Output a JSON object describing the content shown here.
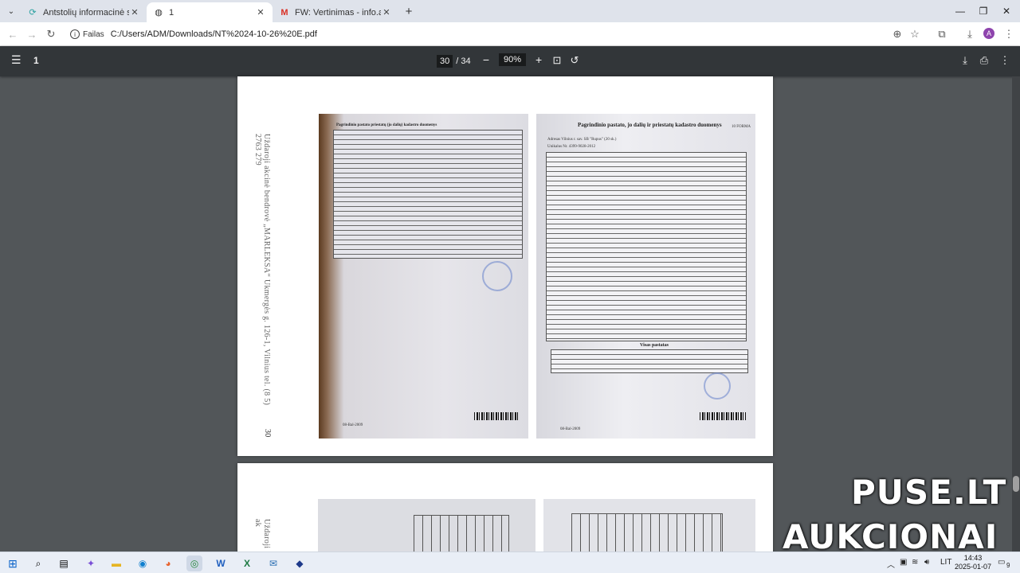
{
  "browser": {
    "tabs": [
      {
        "title": "Antstolių informacinė sistema",
        "icon": "antstoliai-icon",
        "active": false
      },
      {
        "title": "1",
        "icon": "globe-icon",
        "active": true
      },
      {
        "title": "FW: Vertinimas - info.antstoliai@",
        "icon": "gmail-icon",
        "active": false
      }
    ],
    "address": {
      "site_label": "Failas",
      "url": "C:/Users/ADM/Downloads/NT%2024-10-26%20E.pdf"
    },
    "profile_initial": "A"
  },
  "pdf": {
    "title": "1",
    "current_page": "30",
    "page_total": "/ 34",
    "zoom": "90%"
  },
  "page30": {
    "side_text": "Uždaroji akcinė bendrovė „MARLEKSA“  Ukmergės g. 126-1, Vilnius   tel. (8 5) 2763 279",
    "page_number": "30",
    "right_photo": {
      "heading": "Pagrindinio pastato, jo dalių ir priestatų kadastro duomenys",
      "address_line": "Adresas  Vilnius r. sav. SB \"Rupus\" (20 sk.)",
      "code_line": "Unikalus Nr.   4399-9028-2012",
      "form_label": "10 FORMA",
      "totals_heading": "Visas pastatas",
      "date": "08-Bal-2009"
    },
    "left_photo": {
      "heading": "Pagrindinio pastato priestatų (jo dalių) kadastro duomenys",
      "date": "08-Bal-2009"
    }
  },
  "page31": {
    "side_text": "Uždaroji ak"
  },
  "watermark": {
    "line1": "PUSE.LT",
    "line2": "AUKCIONAI"
  },
  "taskbar": {
    "language": "LIT",
    "time": "14:43",
    "date": "2025-01-07",
    "notifications": "9"
  }
}
